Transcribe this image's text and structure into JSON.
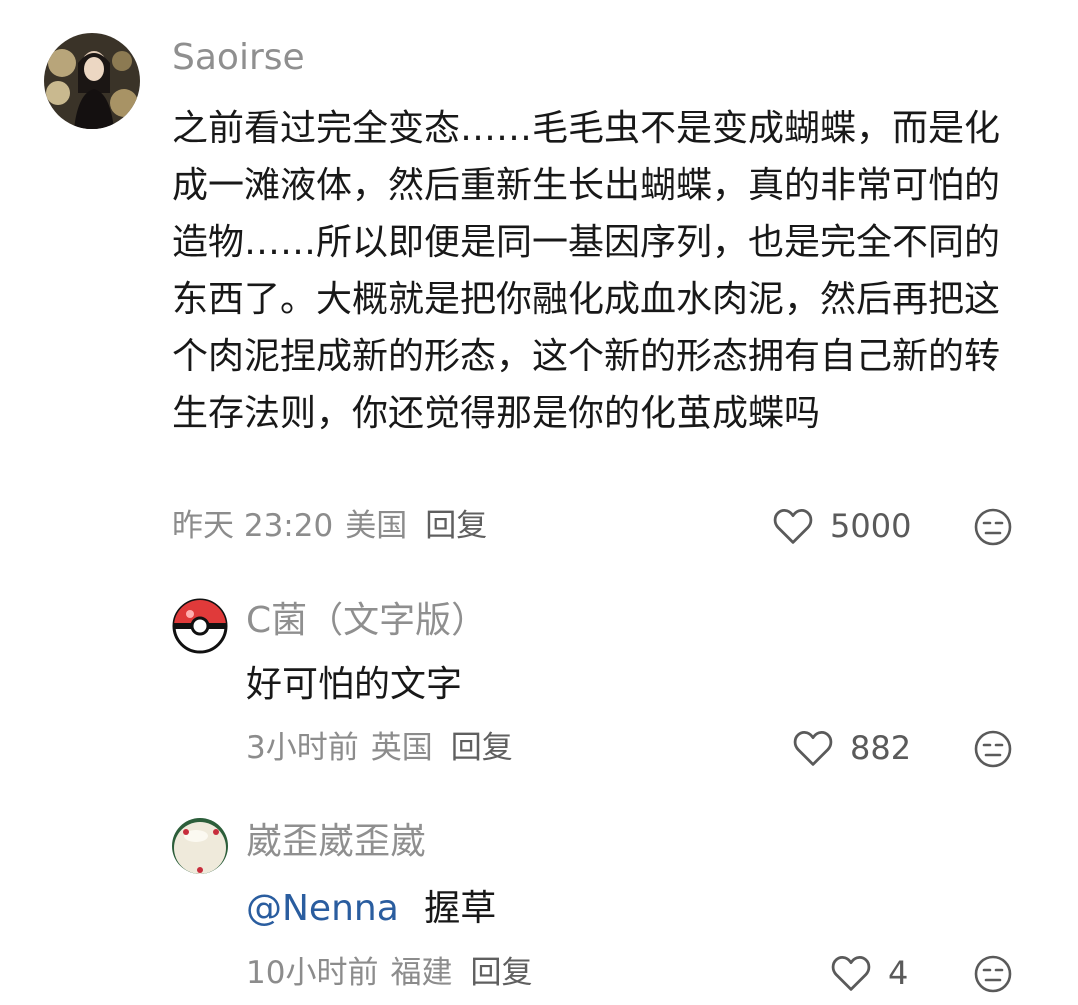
{
  "comment": {
    "username": "Saoirse",
    "text": "之前看过完全变态……毛毛虫不是变成蝴蝶，而是化成一滩液体，然后重新生长出蝴蝶，真的非常可怕的造物……所以即便是同一基因序列，也是完全不同的东西了。大概就是把你融化成血水肉泥，然后再把这个肉泥捏成新的形态，这个新的形态拥有自己新的转生存法则，你还觉得那是你的化茧成蝶吗",
    "time": "昨天 23:20",
    "location": "美国",
    "reply_label": "回复",
    "likes": "5000"
  },
  "replies": [
    {
      "username": "C菌（文字版）",
      "text": "好可怕的文字",
      "mention": "",
      "time": "3小时前",
      "location": "英国",
      "reply_label": "回复",
      "likes": "882"
    },
    {
      "username": "崴歪崴歪崴",
      "mention": "@Nenna",
      "text": "握草",
      "time": "10小时前",
      "location": "福建",
      "reply_label": "回复",
      "likes": "4"
    }
  ],
  "icons": {
    "like": "heart-outline-icon",
    "more": "emoji-face-icon"
  },
  "colors": {
    "username": "#8f8f8f",
    "mention": "#2a5d9f",
    "meta": "#8c8c8c"
  }
}
